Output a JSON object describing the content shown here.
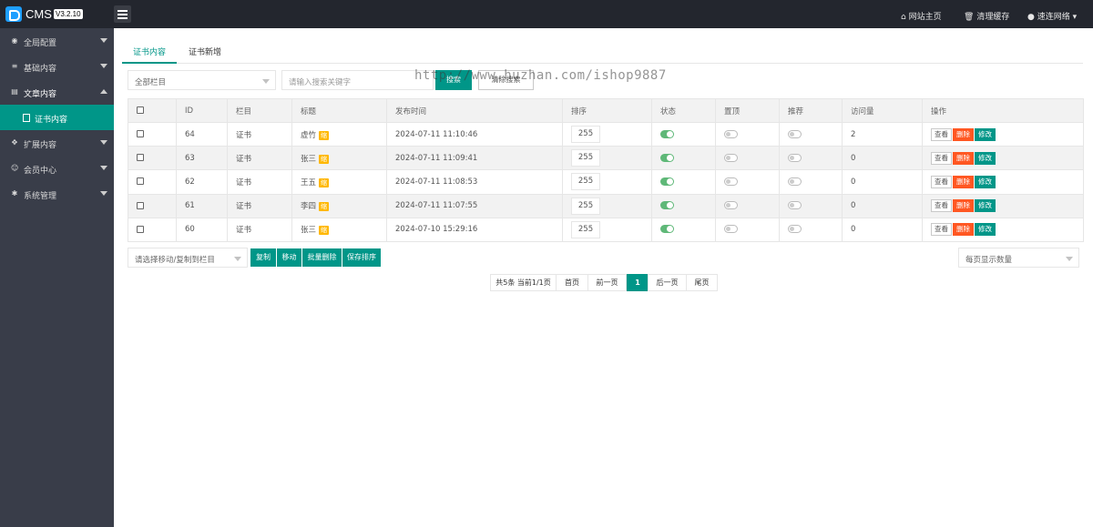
{
  "topbar": {
    "brand": "CMS",
    "version": "V3.2.10",
    "nav": [
      {
        "icon": "home-icon",
        "label": "网站主页"
      },
      {
        "icon": "trash-icon",
        "label": "清理缓存"
      },
      {
        "icon": "user-icon",
        "label": "速连网络"
      }
    ]
  },
  "sidebar": {
    "items": [
      {
        "icon": "globe-icon",
        "label": "全局配置"
      },
      {
        "icon": "sliders-icon",
        "label": "基础内容"
      },
      {
        "icon": "document-icon",
        "label": "文章内容"
      },
      {
        "icon": "expand-icon",
        "label": "扩展内容"
      },
      {
        "icon": "user-icon",
        "label": "会员中心"
      },
      {
        "icon": "gear-icon",
        "label": "系统管理"
      }
    ],
    "active_sub": "证书内容"
  },
  "tabs": [
    "证书内容",
    "证书新增"
  ],
  "filter": {
    "column_select": "全部栏目",
    "search_placeholder": "请输入搜索关键字",
    "search_button": "搜索",
    "clear_button": "清除搜索"
  },
  "watermark": "http://www.huzhan.com/ishop9887",
  "table": {
    "headers": [
      "",
      "ID",
      "栏目",
      "标题",
      "发布时间",
      "排序",
      "状态",
      "置顶",
      "推荐",
      "访问量",
      "操作"
    ],
    "rows": [
      {
        "id": "64",
        "column": "证书",
        "title": "虚竹",
        "tag": "缩",
        "time": "2024-07-11 11:10:46",
        "sort": "255",
        "status": true,
        "top": false,
        "recommend": false,
        "visits": "2"
      },
      {
        "id": "63",
        "column": "证书",
        "title": "张三",
        "tag": "缩",
        "time": "2024-07-11 11:09:41",
        "sort": "255",
        "status": true,
        "top": false,
        "recommend": false,
        "visits": "0"
      },
      {
        "id": "62",
        "column": "证书",
        "title": "王五",
        "tag": "缩",
        "time": "2024-07-11 11:08:53",
        "sort": "255",
        "status": true,
        "top": false,
        "recommend": false,
        "visits": "0"
      },
      {
        "id": "61",
        "column": "证书",
        "title": "李四",
        "tag": "缩",
        "time": "2024-07-11 11:07:55",
        "sort": "255",
        "status": true,
        "top": false,
        "recommend": false,
        "visits": "0"
      },
      {
        "id": "60",
        "column": "证书",
        "title": "张三",
        "tag": "缩",
        "time": "2024-07-10 15:29:16",
        "sort": "255",
        "status": true,
        "top": false,
        "recommend": false,
        "visits": "0"
      }
    ],
    "actions": {
      "view": "查看",
      "delete": "删除",
      "edit": "修改"
    }
  },
  "bulk": {
    "target_select": "请选择移动/复制到栏目",
    "buttons": [
      "复制",
      "移动",
      "批量删除",
      "保存排序"
    ],
    "page_size_select": "每页显示数量"
  },
  "pagination": {
    "summary": "共5条 当前1/1页",
    "first": "首页",
    "prev": "前一页",
    "current": "1",
    "next": "后一页",
    "last": "尾页"
  },
  "colors": {
    "accent": "#009688",
    "danger": "#ff5722",
    "sidebar": "#393d49",
    "topbar": "#23262e",
    "switch_on": "#5fb878"
  }
}
